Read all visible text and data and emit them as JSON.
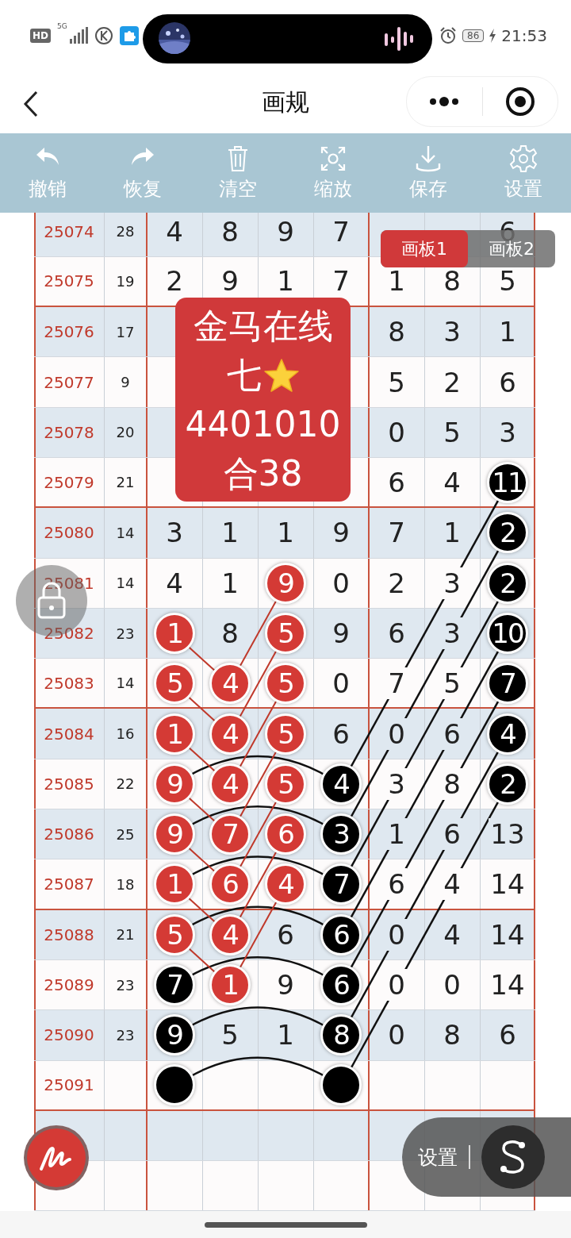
{
  "status_bar": {
    "network_badge": "HD",
    "network_type": "5G",
    "battery": "86",
    "time": "21:53"
  },
  "header": {
    "title": "画规"
  },
  "toolbar": [
    {
      "kind": "undo",
      "label": "撤销"
    },
    {
      "kind": "redo",
      "label": "恢复"
    },
    {
      "kind": "clear",
      "label": "清空"
    },
    {
      "kind": "zoom",
      "label": "缩放"
    },
    {
      "kind": "save",
      "label": "保存"
    },
    {
      "kind": "settings",
      "label": "设置"
    }
  ],
  "tabs": [
    {
      "label": "画板1",
      "selected": true
    },
    {
      "label": "画板2",
      "selected": false
    }
  ],
  "overlay_card": {
    "lines": [
      {
        "kind": "text",
        "text": "金马在线"
      },
      {
        "kind": "text_with_star",
        "text": "七"
      },
      {
        "kind": "text",
        "text": "4401010"
      },
      {
        "kind": "text",
        "text": "合38"
      }
    ]
  },
  "rows": [
    {
      "period": "25074",
      "sum": "28",
      "cells": [
        {
          "text": "4"
        },
        {
          "text": "8"
        },
        {
          "text": "9"
        },
        {
          "text": "7"
        },
        null,
        null,
        {
          "text": "6"
        }
      ]
    },
    {
      "period": "25075",
      "sum": "19",
      "cells": [
        {
          "text": "2"
        },
        {
          "text": "9"
        },
        {
          "text": "1"
        },
        {
          "text": "7"
        },
        {
          "text": "1"
        },
        {
          "text": "8"
        },
        {
          "text": "5"
        }
      ]
    },
    {
      "period": "25076",
      "sum": "17",
      "cells": [
        null,
        null,
        null,
        null,
        {
          "text": "8"
        },
        {
          "text": "3"
        },
        {
          "text": "1"
        }
      ]
    },
    {
      "period": "25077",
      "sum": "9",
      "cells": [
        null,
        null,
        null,
        null,
        {
          "text": "5"
        },
        {
          "text": "2"
        },
        {
          "text": "6"
        }
      ]
    },
    {
      "period": "25078",
      "sum": "20",
      "cells": [
        null,
        null,
        null,
        null,
        {
          "text": "0"
        },
        {
          "text": "5"
        },
        {
          "text": "3"
        }
      ]
    },
    {
      "period": "25079",
      "sum": "21",
      "cells": [
        null,
        null,
        null,
        null,
        {
          "text": "6"
        },
        {
          "text": "4"
        },
        {
          "text": "11",
          "color": "#000000"
        }
      ]
    },
    {
      "period": "25080",
      "sum": "14",
      "cells": [
        {
          "text": "3"
        },
        {
          "text": "1"
        },
        {
          "text": "1"
        },
        {
          "text": "9"
        },
        {
          "text": "7"
        },
        {
          "text": "1"
        },
        {
          "text": "2",
          "color": "#000000"
        }
      ]
    },
    {
      "period": "25081",
      "sum": "14",
      "cells": [
        {
          "text": "4"
        },
        {
          "text": "1"
        },
        {
          "text": "9",
          "color": "#d43a35"
        },
        {
          "text": "0"
        },
        {
          "text": "2"
        },
        {
          "text": "3"
        },
        {
          "text": "2",
          "color": "#000000"
        }
      ]
    },
    {
      "period": "25082",
      "sum": "23",
      "cells": [
        {
          "text": "1",
          "color": "#d43a35"
        },
        {
          "text": "8"
        },
        {
          "text": "5",
          "color": "#d43a35"
        },
        {
          "text": "9"
        },
        {
          "text": "6"
        },
        {
          "text": "3"
        },
        {
          "text": "10",
          "color": "#000000"
        }
      ]
    },
    {
      "period": "25083",
      "sum": "14",
      "cells": [
        {
          "text": "5",
          "color": "#d43a35"
        },
        {
          "text": "4",
          "color": "#d43a35"
        },
        {
          "text": "5",
          "color": "#d43a35"
        },
        {
          "text": "0"
        },
        {
          "text": "7"
        },
        {
          "text": "5"
        },
        {
          "text": "7",
          "color": "#000000"
        }
      ]
    },
    {
      "period": "25084",
      "sum": "16",
      "cells": [
        {
          "text": "1",
          "color": "#d43a35"
        },
        {
          "text": "4",
          "color": "#d43a35"
        },
        {
          "text": "5",
          "color": "#d43a35"
        },
        {
          "text": "6"
        },
        {
          "text": "0"
        },
        {
          "text": "6"
        },
        {
          "text": "4",
          "color": "#000000"
        }
      ]
    },
    {
      "period": "25085",
      "sum": "22",
      "cells": [
        {
          "text": "9",
          "color": "#d43a35"
        },
        {
          "text": "4",
          "color": "#d43a35"
        },
        {
          "text": "5",
          "color": "#d43a35"
        },
        {
          "text": "4",
          "color": "#000000"
        },
        {
          "text": "3"
        },
        {
          "text": "8"
        },
        {
          "text": "2",
          "color": "#000000"
        }
      ]
    },
    {
      "period": "25086",
      "sum": "25",
      "cells": [
        {
          "text": "9",
          "color": "#d43a35"
        },
        {
          "text": "7",
          "color": "#d43a35"
        },
        {
          "text": "6",
          "color": "#d43a35"
        },
        {
          "text": "3",
          "color": "#000000"
        },
        {
          "text": "1"
        },
        {
          "text": "6"
        },
        {
          "text": "13"
        }
      ]
    },
    {
      "period": "25087",
      "sum": "18",
      "cells": [
        {
          "text": "1",
          "color": "#d43a35"
        },
        {
          "text": "6",
          "color": "#d43a35"
        },
        {
          "text": "4",
          "color": "#d43a35"
        },
        {
          "text": "7",
          "color": "#000000"
        },
        {
          "text": "6"
        },
        {
          "text": "4"
        },
        {
          "text": "14"
        }
      ]
    },
    {
      "period": "25088",
      "sum": "21",
      "cells": [
        {
          "text": "5",
          "color": "#d43a35"
        },
        {
          "text": "4",
          "color": "#d43a35"
        },
        {
          "text": "6"
        },
        {
          "text": "6",
          "color": "#000000"
        },
        {
          "text": "0"
        },
        {
          "text": "4"
        },
        {
          "text": "14"
        }
      ]
    },
    {
      "period": "25089",
      "sum": "23",
      "cells": [
        {
          "text": "7",
          "color": "#000000"
        },
        {
          "text": "1",
          "color": "#d43a35"
        },
        {
          "text": "9"
        },
        {
          "text": "6",
          "color": "#000000"
        },
        {
          "text": "0"
        },
        {
          "text": "0"
        },
        {
          "text": "14"
        }
      ]
    },
    {
      "period": "25090",
      "sum": "23",
      "cells": [
        {
          "text": "9",
          "color": "#000000"
        },
        {
          "text": "5"
        },
        {
          "text": "1"
        },
        {
          "text": "8",
          "color": "#000000"
        },
        {
          "text": "0"
        },
        {
          "text": "8"
        },
        {
          "text": "6"
        }
      ]
    },
    {
      "period": "25091",
      "cells": [
        {
          "color": "#000000"
        },
        null,
        null,
        {
          "color": "#000000"
        },
        null,
        null,
        null
      ]
    },
    {
      "cells": [
        null,
        null,
        null,
        null,
        null,
        null,
        null
      ]
    },
    {
      "cells": [
        null,
        null,
        null,
        null,
        null,
        null,
        null
      ]
    }
  ],
  "float_panel": {
    "label": "设置"
  }
}
